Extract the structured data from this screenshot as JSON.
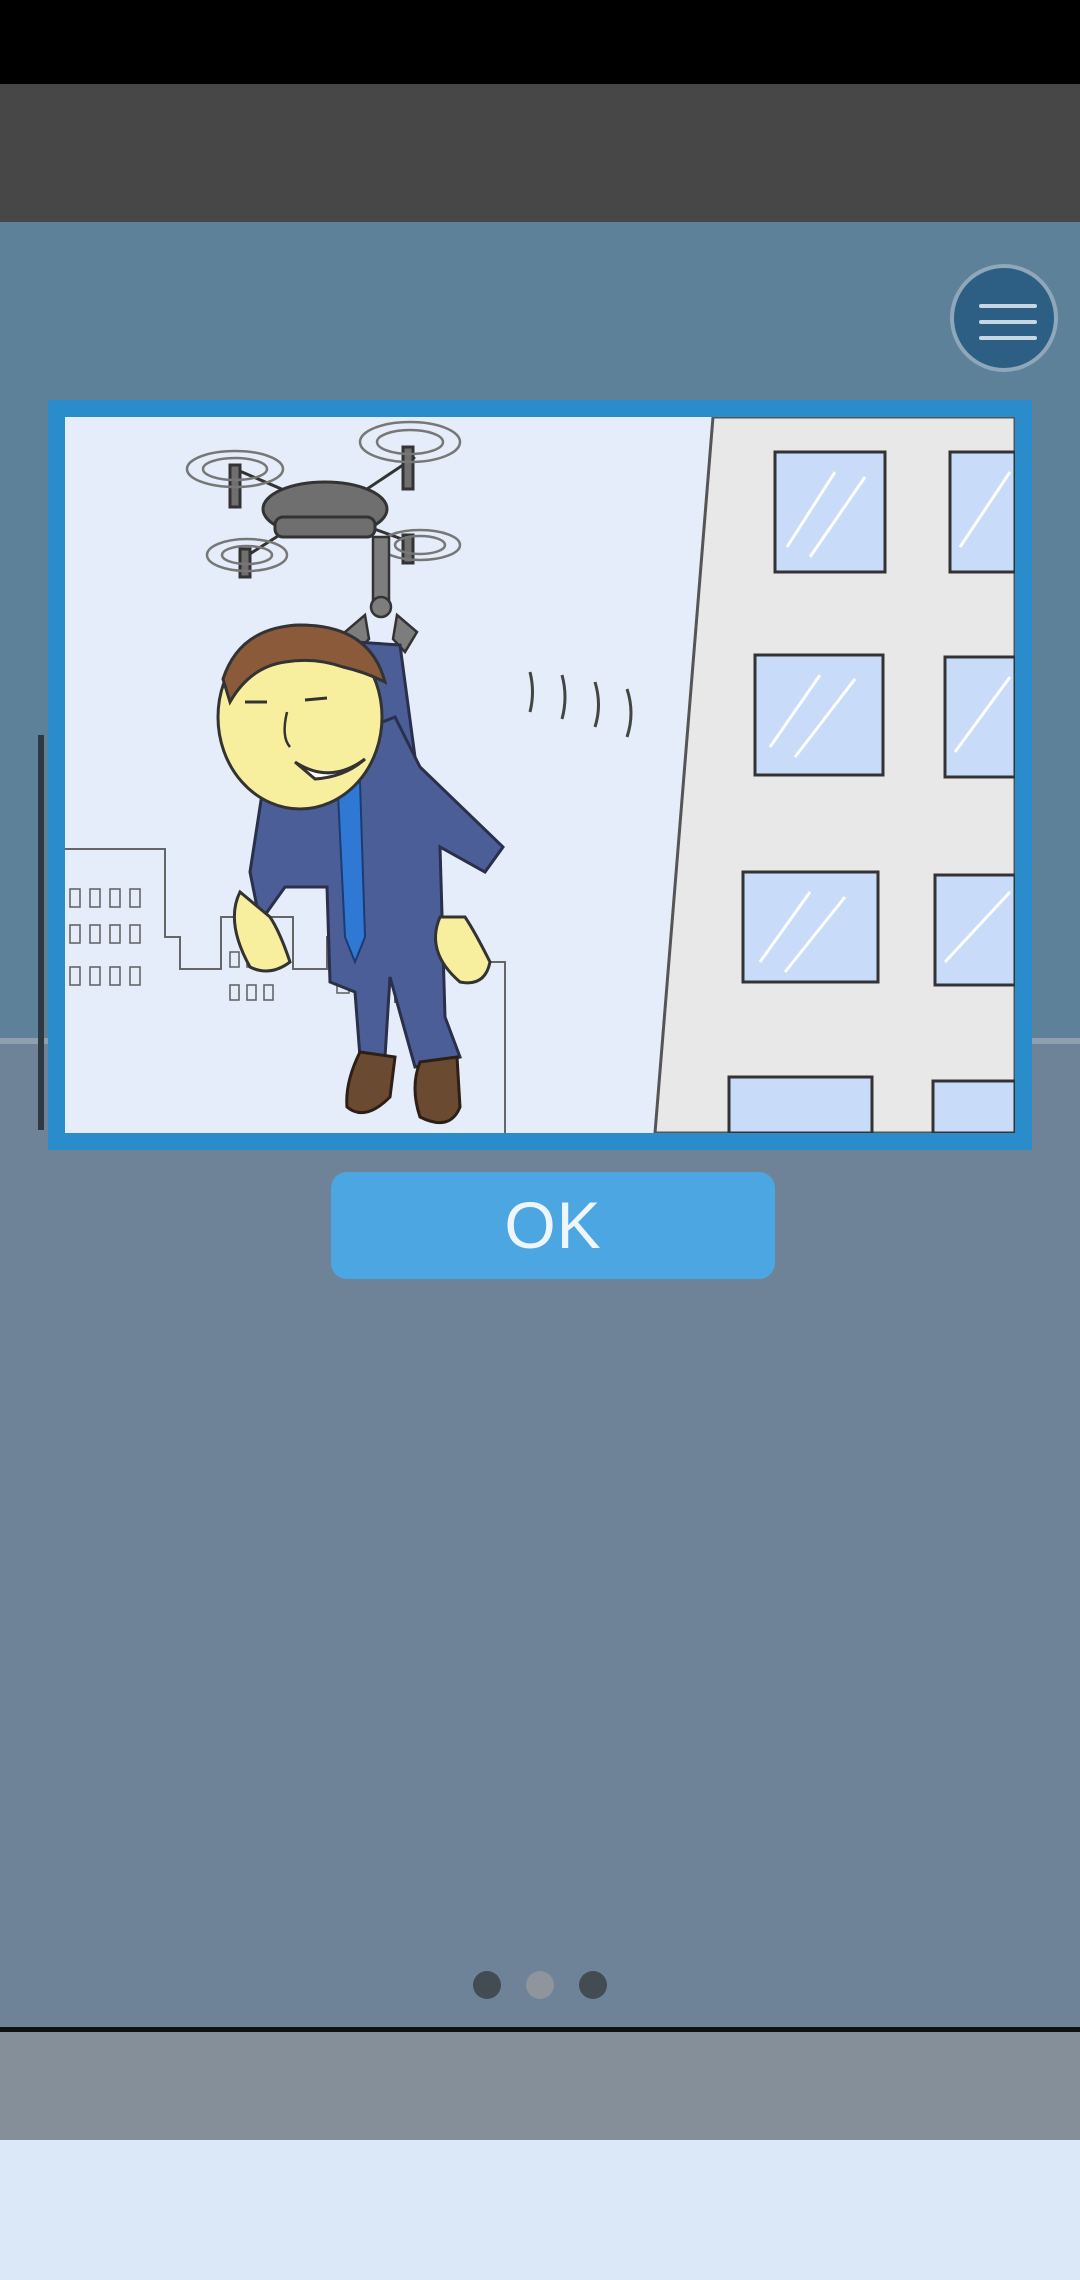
{
  "dialog": {
    "ok_label": "OK",
    "illustration": "salaryman-carried-by-drone-icon"
  },
  "menu": {
    "icon": "hamburger-menu-icon"
  },
  "pagination": {
    "pages": 3,
    "current": 2
  },
  "colors": {
    "frame": "#2b8ccb",
    "ok_button": "#4ba6e1",
    "scene_upper": "#5d8198",
    "scene_lower": "#6e8397",
    "top_bar": "#474747",
    "dot_active": "#8e959c",
    "dot_inactive": "#434b53"
  }
}
